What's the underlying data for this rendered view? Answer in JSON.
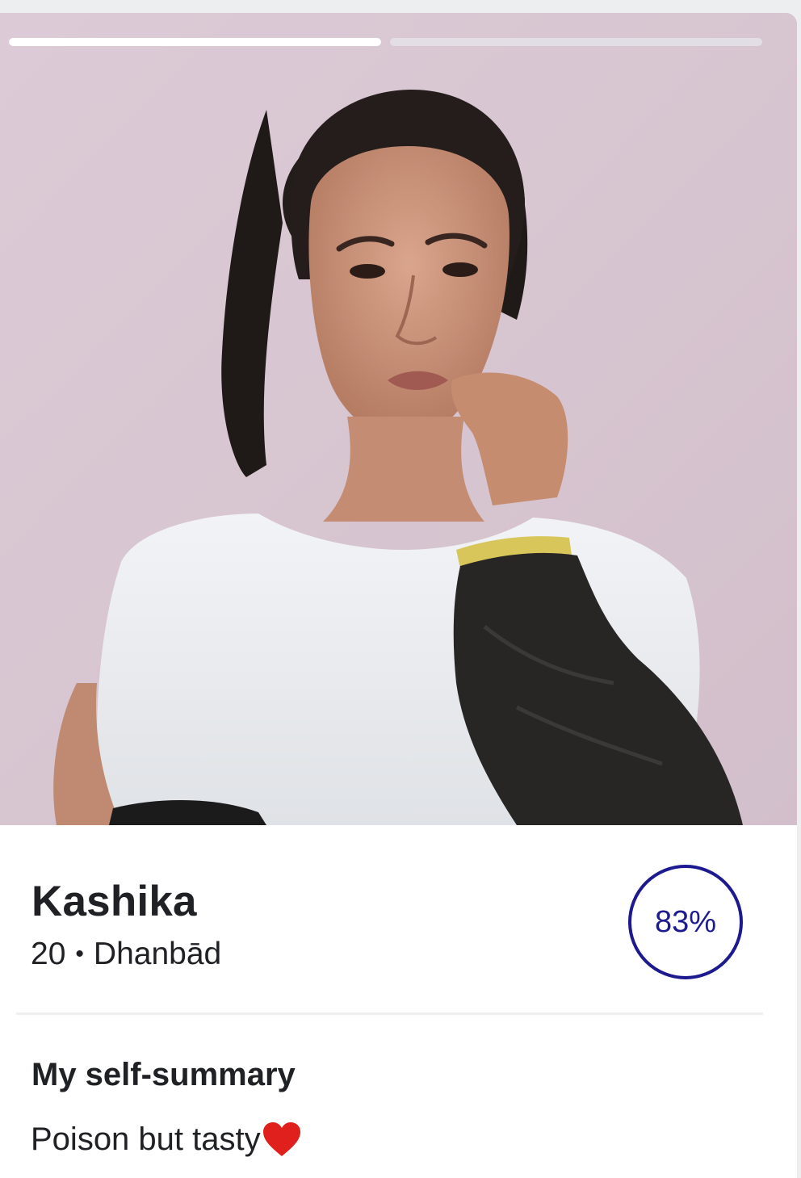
{
  "story": {
    "segments": 2,
    "current": 1,
    "segment_progress": [
      1.0,
      0.0
    ]
  },
  "profile": {
    "name": "Kashika",
    "age": "20",
    "separator": "•",
    "location": "Dhanbād",
    "match": "83%"
  },
  "summary": {
    "title": "My self-summary",
    "text": "Poison but tasty"
  },
  "icons": {
    "heart": "heart-icon"
  },
  "colors": {
    "match_ring": "#1d1a8f",
    "text": "#202124",
    "heart": "#e0201d"
  }
}
